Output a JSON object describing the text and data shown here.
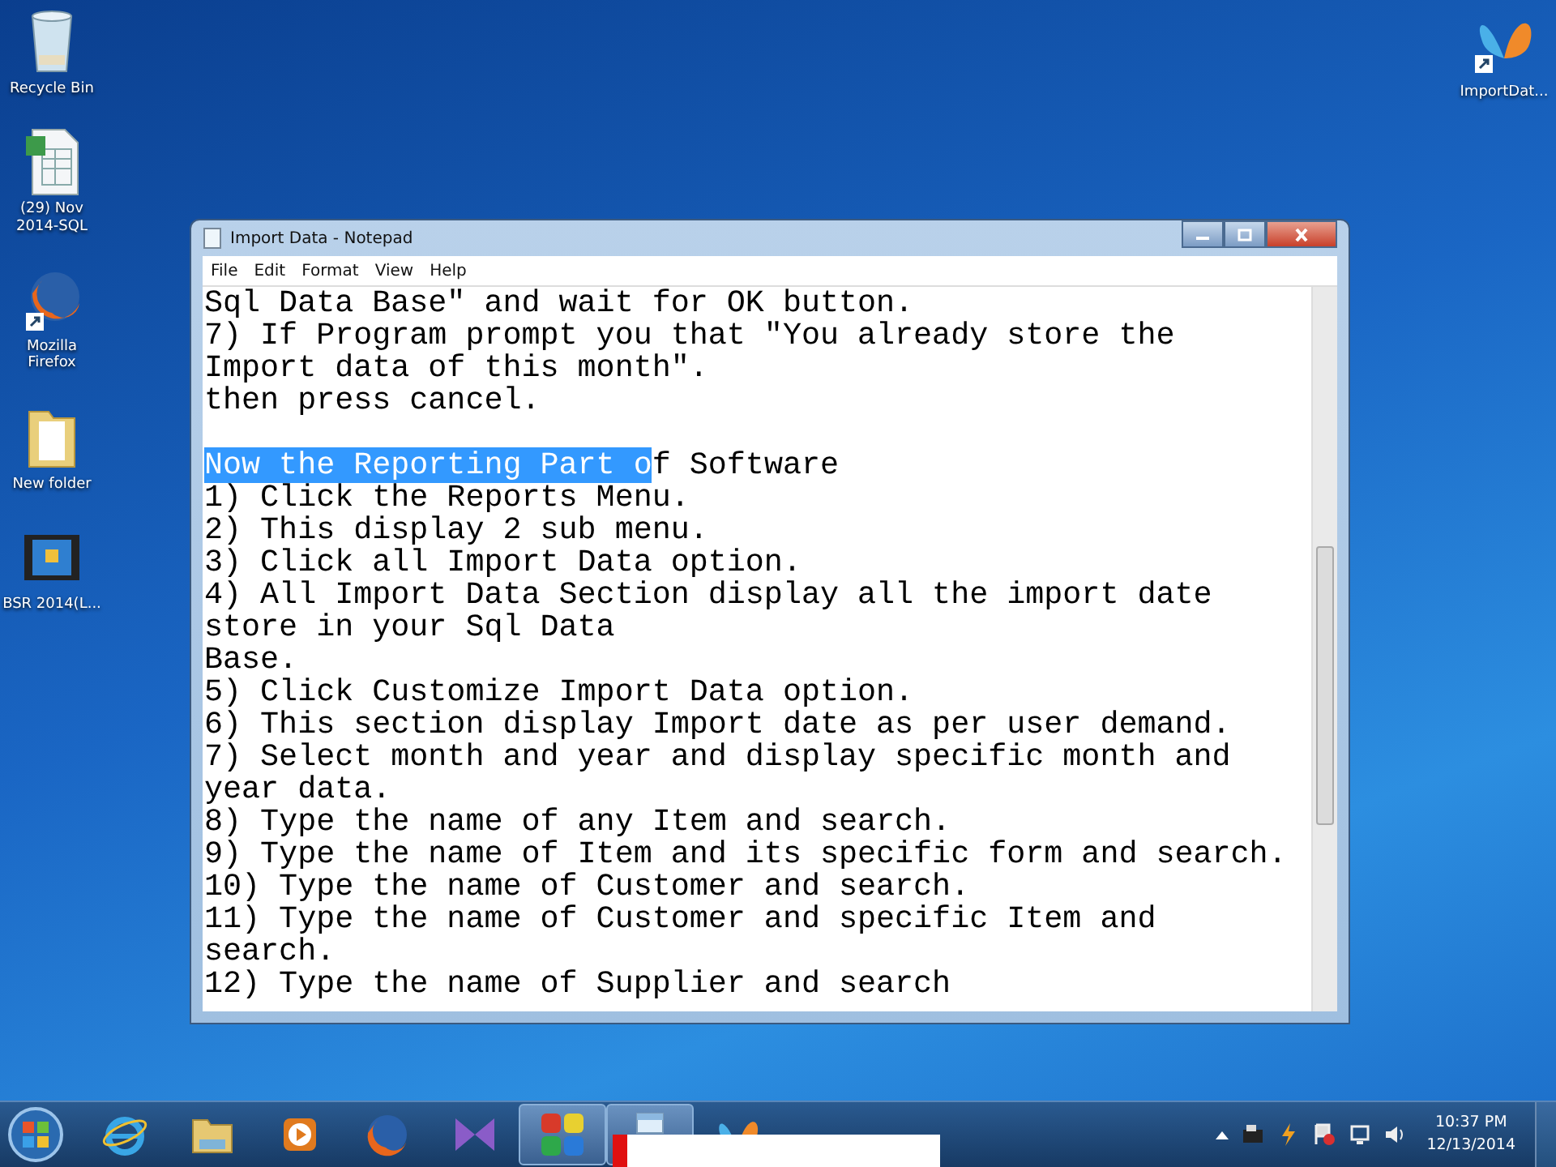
{
  "desktop_icons": [
    {
      "kind": "recycle",
      "label": "Recycle Bin"
    },
    {
      "kind": "spreadsheet",
      "label": "(29) Nov 2014-SQL"
    },
    {
      "kind": "firefox",
      "label": "Mozilla Firefox"
    },
    {
      "kind": "folder",
      "label": "New folder"
    },
    {
      "kind": "video",
      "label": "BSR 2014(L..."
    },
    {
      "kind": "butterfly",
      "label": "ImportDat..."
    }
  ],
  "window": {
    "title": "Import Data - Notepad",
    "menu": [
      "File",
      "Edit",
      "Format",
      "View",
      "Help"
    ],
    "lines": [
      {
        "kind": "text",
        "text": "Sql Data Base\" and wait for OK button."
      },
      {
        "kind": "text",
        "text": "7) If Program prompt you that \"You already store the"
      },
      {
        "kind": "text",
        "text": "Import data of this month\"."
      },
      {
        "kind": "text",
        "text": "then press cancel."
      },
      {
        "kind": "blank"
      },
      {
        "kind": "text",
        "selected_text": "Now the Reporting Part o",
        "text": "f Software"
      },
      {
        "kind": "text",
        "text": "1) Click the Reports Menu."
      },
      {
        "kind": "text",
        "text": "2) This display 2 sub menu."
      },
      {
        "kind": "text",
        "text": "3) Click all Import Data option."
      },
      {
        "kind": "text",
        "text": "4) All Import Data Section display all the import date"
      },
      {
        "kind": "text",
        "text": "store in your Sql Data"
      },
      {
        "kind": "text",
        "text": "Base."
      },
      {
        "kind": "text",
        "text": "5) Click Customize Import Data option."
      },
      {
        "kind": "text",
        "text": "6) This section display Import date as per user demand."
      },
      {
        "kind": "text",
        "text": "7) Select month and year and display specific month and"
      },
      {
        "kind": "text",
        "text": "year data."
      },
      {
        "kind": "text",
        "text": "8) Type the name of any Item and search."
      },
      {
        "kind": "text",
        "text": "9) Type the name of Item and its specific form and search."
      },
      {
        "kind": "text",
        "text": "10) Type the name of Customer and search."
      },
      {
        "kind": "text",
        "text": "11) Type the name of Customer and specific Item and"
      },
      {
        "kind": "text",
        "text": "search."
      },
      {
        "kind": "text",
        "text": "12) Type the name of Supplier and search"
      }
    ]
  },
  "taskbar": {
    "items": [
      {
        "kind": "ie",
        "selected": false
      },
      {
        "kind": "explorer",
        "selected": false
      },
      {
        "kind": "media",
        "selected": false
      },
      {
        "kind": "firefox",
        "selected": false
      },
      {
        "kind": "bowtie",
        "selected": false
      },
      {
        "kind": "tiles",
        "selected": true
      },
      {
        "kind": "notepad",
        "selected": true
      },
      {
        "kind": "butterfly",
        "selected": false
      }
    ],
    "time": "10:37 PM",
    "date": "12/13/2014"
  }
}
